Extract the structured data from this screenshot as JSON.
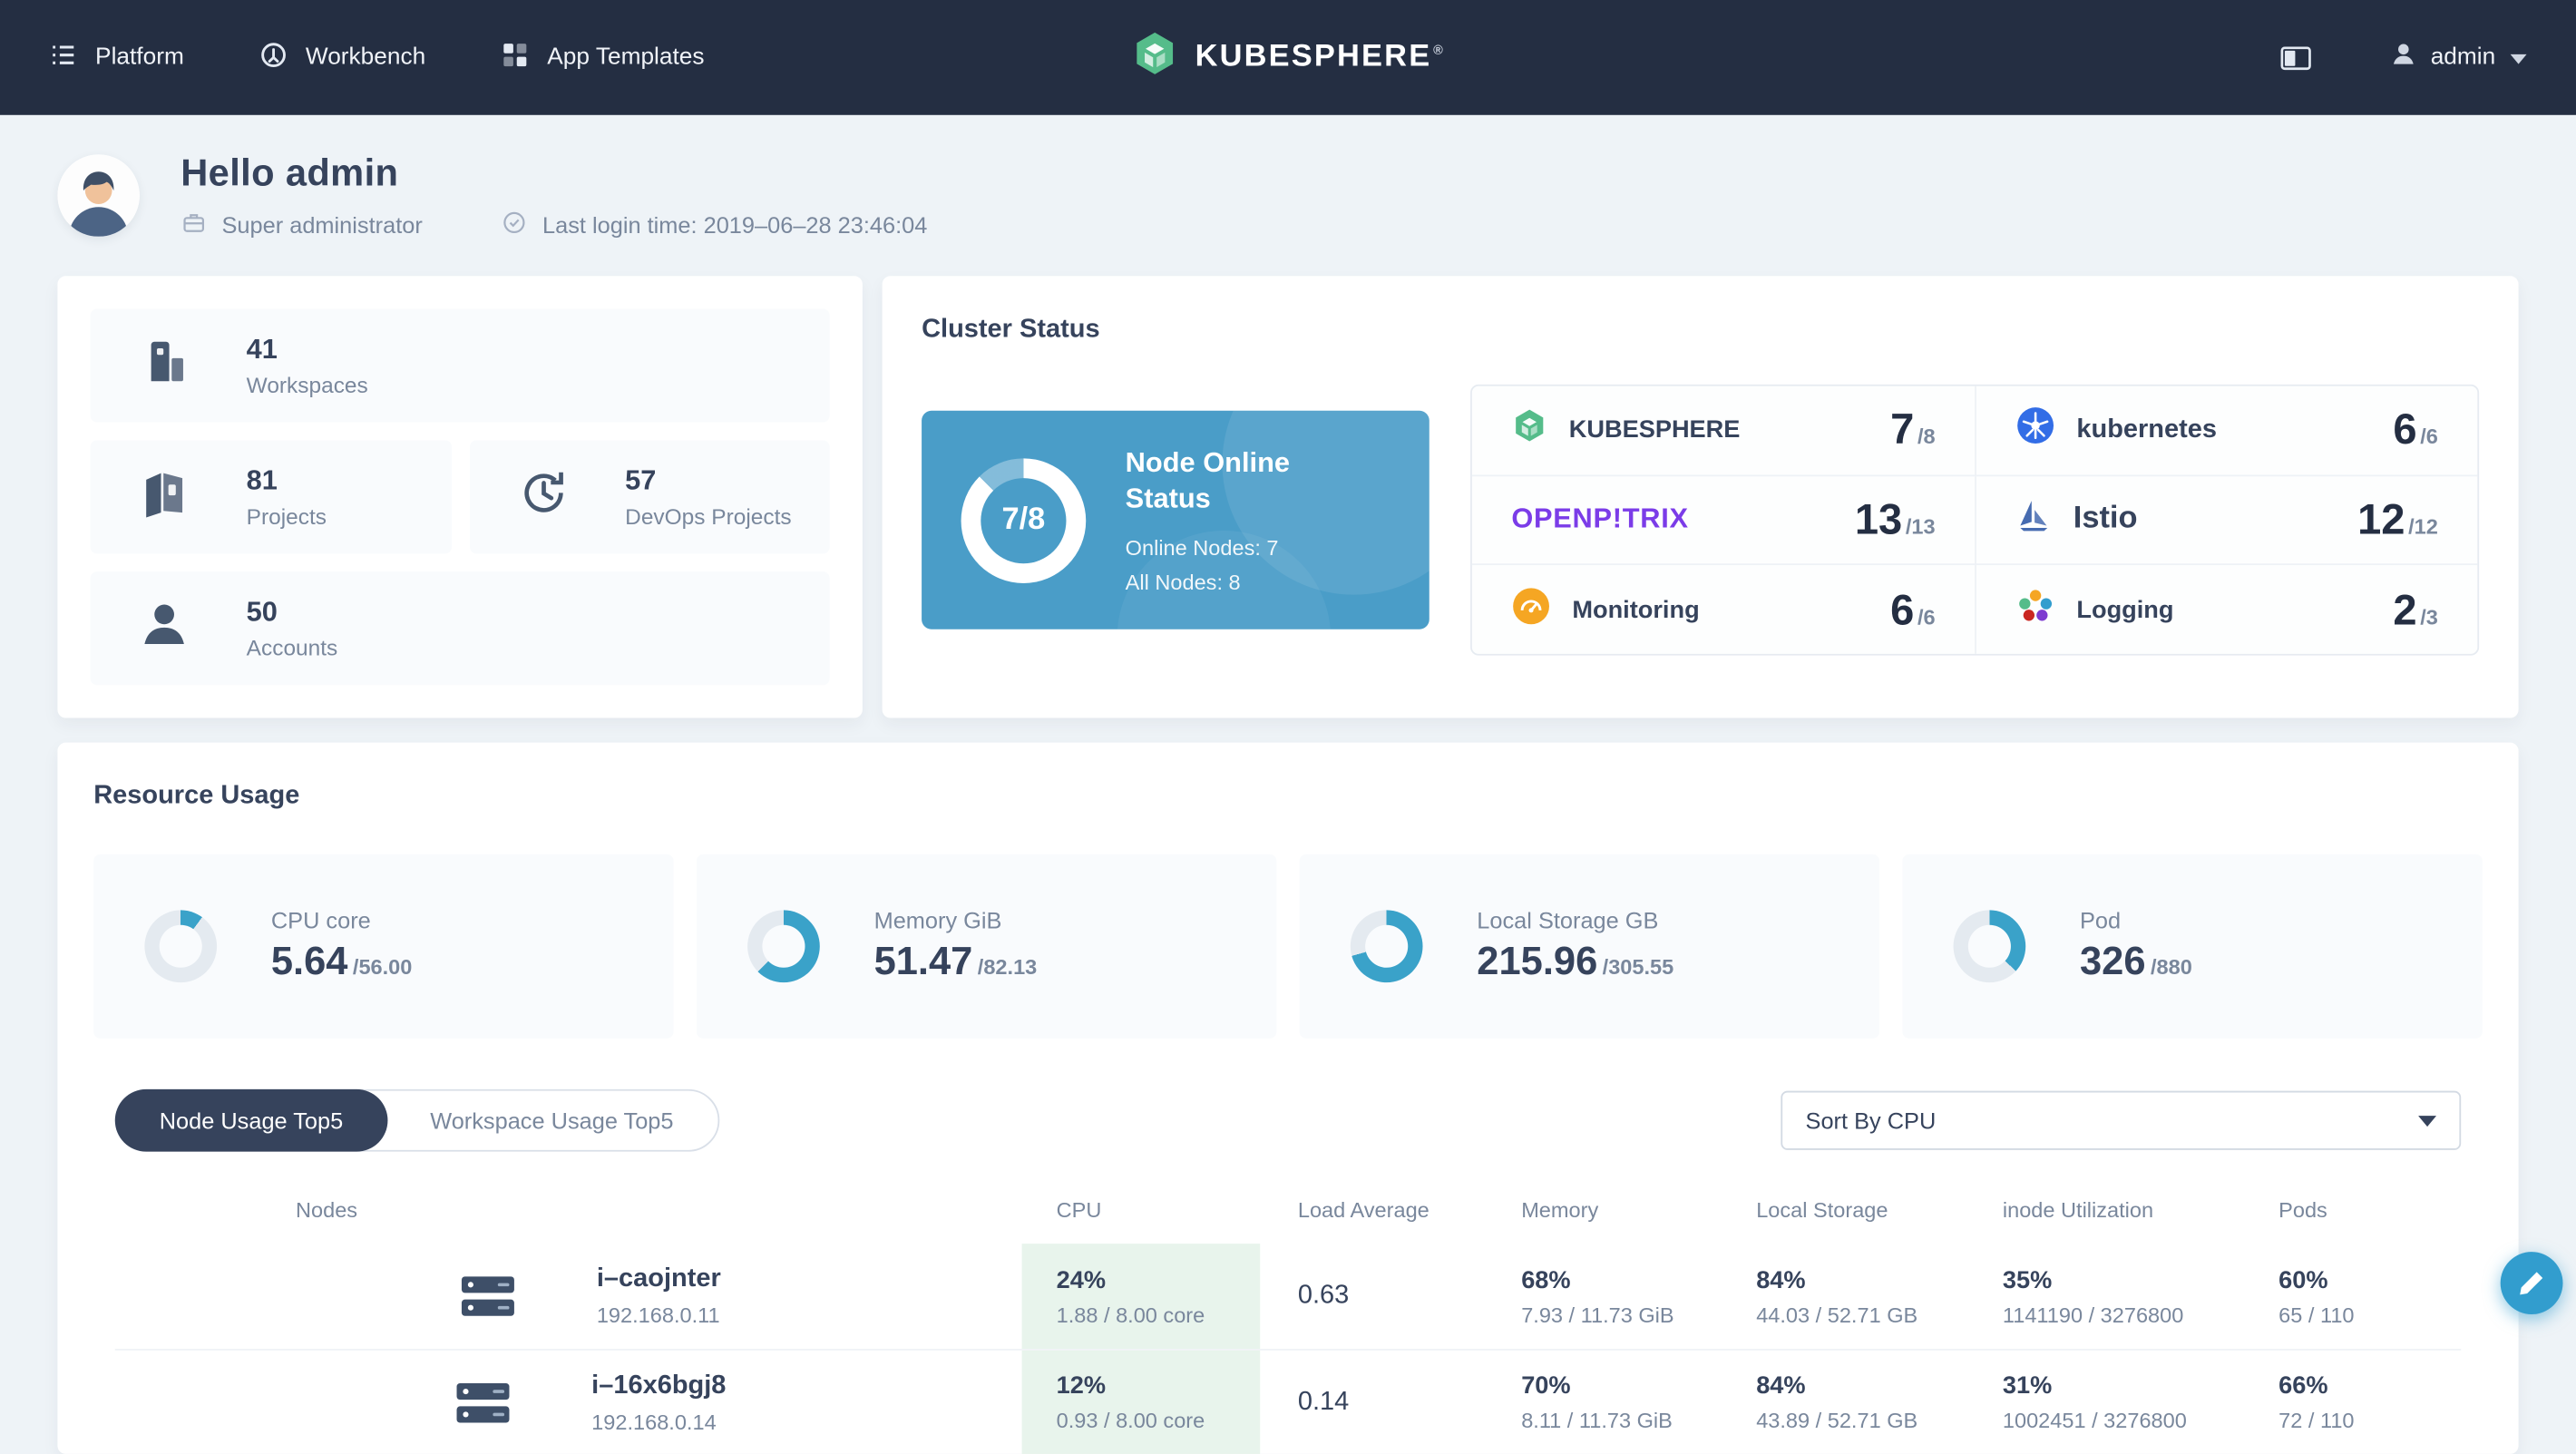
{
  "nav": {
    "menu": [
      {
        "label": "Platform"
      },
      {
        "label": "Workbench"
      },
      {
        "label": "App Templates"
      }
    ],
    "brand": "KUBESPHERE",
    "brand_reg": "®",
    "user": "admin"
  },
  "header": {
    "greeting": "Hello admin",
    "role": "Super administrator",
    "last_login": "Last login time: 2019–06–28 23:46:04"
  },
  "stats": [
    {
      "value": "41",
      "label": "Workspaces"
    },
    {
      "value": "81",
      "label": "Projects"
    },
    {
      "value": "57",
      "label": "DevOps Projects"
    },
    {
      "value": "50",
      "label": "Accounts"
    }
  ],
  "cluster": {
    "title": "Cluster Status",
    "node_online": {
      "fraction": "7/8",
      "pct": 87.5,
      "title": "Node Online Status",
      "online": "Online Nodes: 7",
      "all": "All Nodes: 8"
    },
    "components": [
      {
        "name": "KUBESPHERE",
        "value": "7",
        "total": "/8"
      },
      {
        "name": "kubernetes",
        "value": "6",
        "total": "/6"
      },
      {
        "name": "OPENP!TRIX",
        "value": "13",
        "total": "/13"
      },
      {
        "name": "Istio",
        "value": "12",
        "total": "/12"
      },
      {
        "name": "Monitoring",
        "value": "6",
        "total": "/6"
      },
      {
        "name": "Logging",
        "value": "2",
        "total": "/3"
      }
    ]
  },
  "resources": {
    "title": "Resource Usage",
    "gauges": [
      {
        "label": "CPU core",
        "used": "5.64",
        "total": "/56.00",
        "pct": 10.1
      },
      {
        "label": "Memory GiB",
        "used": "51.47",
        "total": "/82.13",
        "pct": 62.7
      },
      {
        "label": "Local Storage GB",
        "used": "215.96",
        "total": "/305.55",
        "pct": 70.7
      },
      {
        "label": "Pod",
        "used": "326",
        "total": "/880",
        "pct": 37.0
      }
    ],
    "tabs": [
      {
        "label": "Node Usage Top5"
      },
      {
        "label": "Workspace Usage Top5"
      }
    ],
    "sort_by": "Sort By CPU",
    "table": {
      "headers": [
        "Nodes",
        "CPU",
        "Load Average",
        "Memory",
        "Local Storage",
        "inode Utilization",
        "Pods"
      ],
      "rows": [
        {
          "name": "i–caojnter",
          "ip": "192.168.0.11",
          "cpu": "24%",
          "cpu_detail": "1.88 / 8.00 core",
          "load": "0.63",
          "memory": "68%",
          "memory_detail": "7.93 / 11.73 GiB",
          "storage": "84%",
          "storage_detail": "44.03 / 52.71 GB",
          "inode": "35%",
          "inode_detail": "1141190 / 3276800",
          "pods": "60%",
          "pods_detail": "65 / 110"
        },
        {
          "name": "i–16x6bgj8",
          "ip": "192.168.0.14",
          "cpu": "12%",
          "cpu_detail": "0.93 / 8.00 core",
          "load": "0.14",
          "memory": "70%",
          "memory_detail": "8.11 / 11.73 GiB",
          "storage": "84%",
          "storage_detail": "43.89 / 52.71 GB",
          "inode": "31%",
          "inode_detail": "1002451 / 3276800",
          "pods": "66%",
          "pods_detail": "72 / 110"
        }
      ]
    }
  },
  "colors": {
    "nav_bg": "#242e42",
    "accent_green": "#55bc8a",
    "accent_blue": "#329dce",
    "node_card_blue": "#4a9dc8",
    "cpu_cell_green": "#e8f4ec",
    "gauge_arc": "#3aa2c9"
  }
}
